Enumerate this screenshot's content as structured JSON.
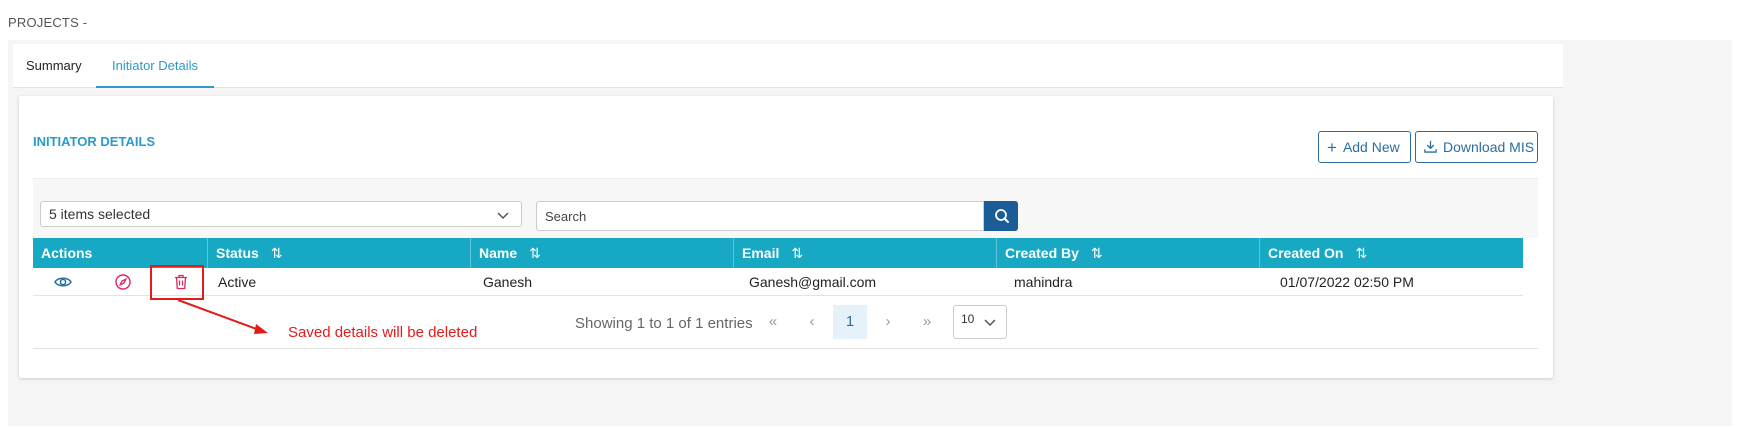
{
  "page": {
    "title": "PROJECTS -"
  },
  "tabs": [
    {
      "label": "Summary",
      "active": false
    },
    {
      "label": "Initiator Details",
      "active": true
    }
  ],
  "card": {
    "title": "INITIATOR DETAILS",
    "add_new_label": "Add New",
    "download_label": "Download MIS"
  },
  "filters": {
    "columns_selected": "5 items selected",
    "search_placeholder": "Search"
  },
  "table": {
    "headers": [
      "Actions",
      "Status",
      "Name",
      "Email",
      "Created By",
      "Created On"
    ],
    "rows": [
      {
        "status": "Active",
        "name": "Ganesh",
        "email": "Ganesh@gmail.com",
        "created_by": "mahindra",
        "created_on": "01/07/2022 02:50 PM"
      }
    ]
  },
  "pagination": {
    "info": "Showing 1 to 1 of 1 entries",
    "first": "«",
    "prev": "‹",
    "current_page": "1",
    "next": "›",
    "last": "»",
    "page_size": "10"
  },
  "annotation": {
    "text": "Saved details will be deleted",
    "color": "#e21b1b"
  },
  "colors": {
    "accent": "#2a9bc8",
    "header_bg": "#17a8c4",
    "primary_btn": "#1a5d96"
  }
}
